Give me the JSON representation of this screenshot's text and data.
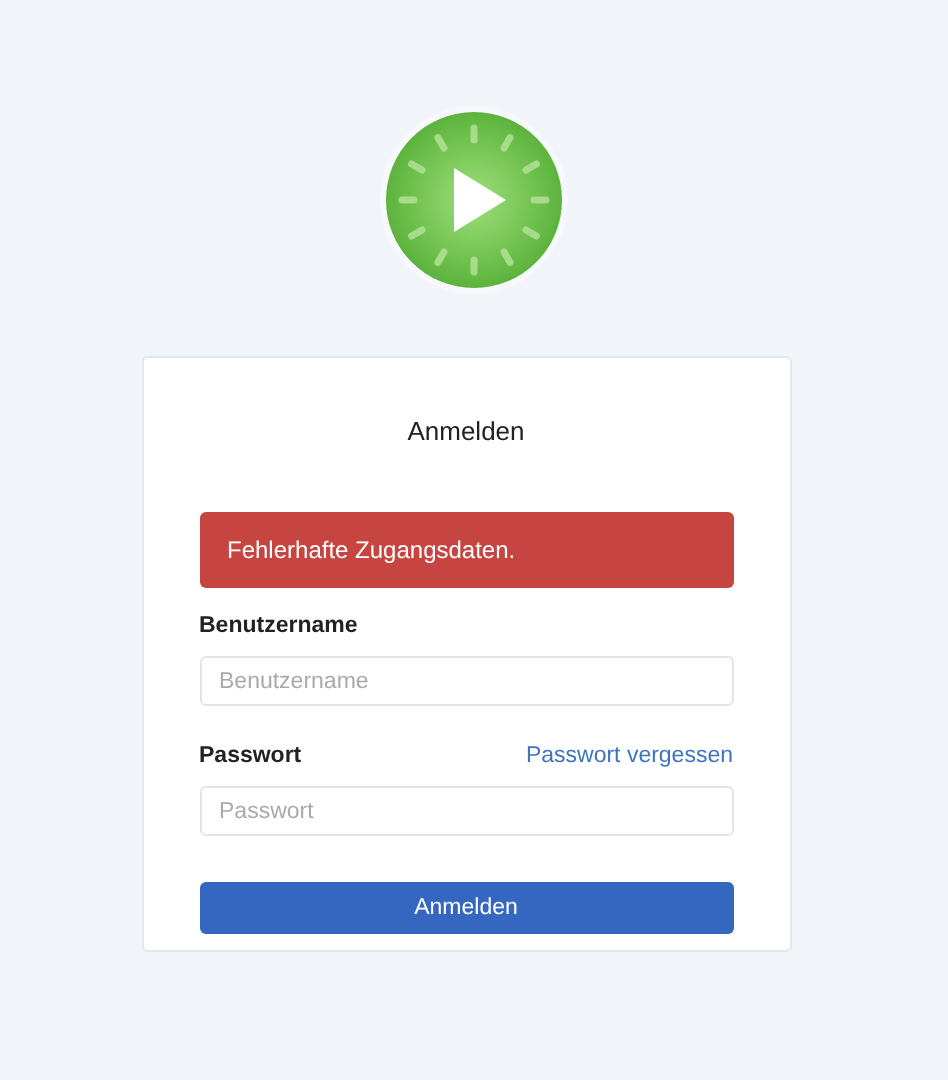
{
  "title": "Anmelden",
  "alert": "Fehlerhafte Zugangsdaten.",
  "fields": [
    {
      "label": "Benutzername",
      "placeholder": "Benutzername"
    },
    {
      "label": "Passwort",
      "placeholder": "Passwort",
      "link": "Passwort vergessen"
    }
  ],
  "submit": "Anmelden"
}
